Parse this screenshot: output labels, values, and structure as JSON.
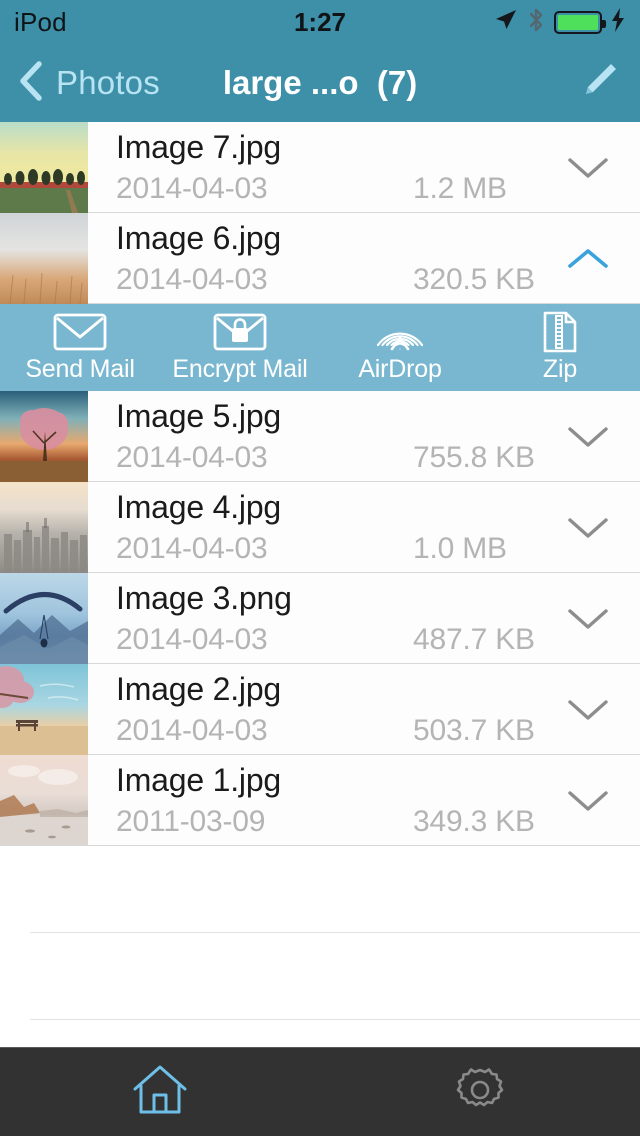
{
  "status_bar": {
    "carrier": "iPod",
    "time": "1:27",
    "icons": [
      "location-arrow-icon",
      "bluetooth-icon",
      "battery-icon",
      "charging-bolt-icon"
    ],
    "battery_color": "#4ee05a"
  },
  "nav_bar": {
    "back_label": "Photos",
    "title": "large ...o  (7)",
    "edit_icon": "pencil-icon",
    "background": "#3d90a8"
  },
  "files": [
    {
      "name": "Image 7.jpg",
      "date": "2014-04-03",
      "size": "1.2 MB",
      "chevron": "chevron-down-icon",
      "expanded": false
    },
    {
      "name": "Image 6.jpg",
      "date": "2014-04-03",
      "size": "320.5 KB",
      "chevron": "chevron-up-icon",
      "expanded": true
    },
    {
      "name": "Image 5.jpg",
      "date": "2014-04-03",
      "size": "755.8 KB",
      "chevron": "chevron-down-icon",
      "expanded": false
    },
    {
      "name": "Image 4.jpg",
      "date": "2014-04-03",
      "size": "1.0 MB",
      "chevron": "chevron-down-icon",
      "expanded": false
    },
    {
      "name": "Image 3.png",
      "date": "2014-04-03",
      "size": "487.7 KB",
      "chevron": "chevron-down-icon",
      "expanded": false
    },
    {
      "name": "Image 2.jpg",
      "date": "2014-04-03",
      "size": "503.7 KB",
      "chevron": "chevron-down-icon",
      "expanded": false
    },
    {
      "name": "Image 1.jpg",
      "date": "2011-03-09",
      "size": "349.3 KB",
      "chevron": "chevron-down-icon",
      "expanded": false
    }
  ],
  "action_bar": {
    "background": "#79b7d0",
    "actions": [
      {
        "label": "Send Mail",
        "icon": "envelope-icon"
      },
      {
        "label": "Encrypt Mail",
        "icon": "envelope-lock-icon"
      },
      {
        "label": "AirDrop",
        "icon": "airdrop-icon"
      },
      {
        "label": "Zip",
        "icon": "zip-file-icon"
      }
    ]
  },
  "tab_bar": {
    "background": "#323232",
    "tabs": [
      {
        "icon": "home-icon",
        "active": true,
        "color": "#6ec0e8"
      },
      {
        "icon": "gear-icon",
        "active": false,
        "color": "#8a8a8a"
      }
    ]
  },
  "accent_color": "#3d90a8",
  "chevron_active_color": "#3aa3dd",
  "chevron_inactive_color": "#8d8d8d"
}
